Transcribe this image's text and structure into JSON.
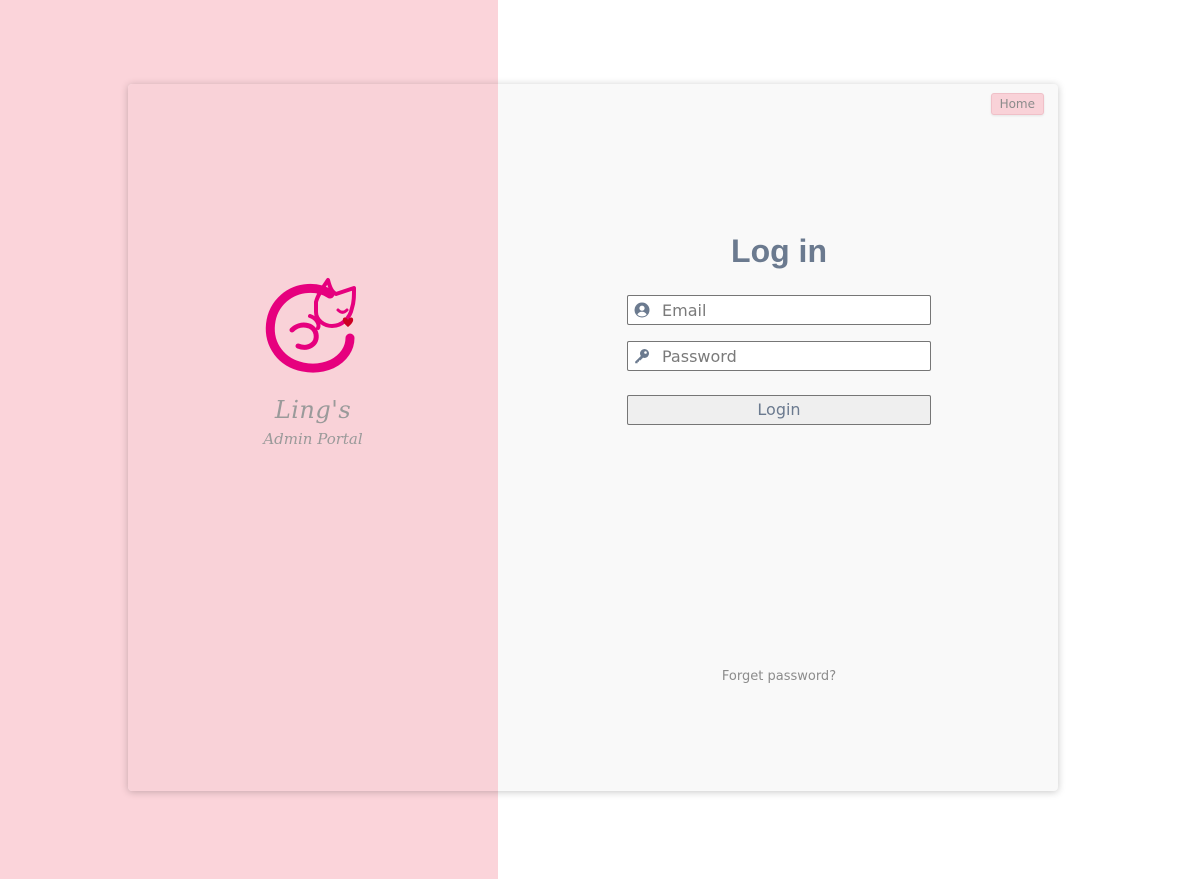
{
  "brand": {
    "name": "Ling's",
    "subtitle": "Admin Portal",
    "logo_icon": "cat-logo-icon",
    "logo_color": "#e6007e",
    "heart_color": "#cc0022"
  },
  "nav": {
    "home_label": "Home"
  },
  "login": {
    "title": "Log in",
    "email_placeholder": "Email",
    "email_icon": "user-circle-icon",
    "password_placeholder": "Password",
    "password_icon": "key-icon",
    "submit_label": "Login",
    "forgot_label": "Forget password?"
  },
  "colors": {
    "pink_background": "#fbd4da",
    "card_background": "#f9f9f9",
    "title_color": "#6b7a8f",
    "muted_text": "#8c8c8c"
  }
}
